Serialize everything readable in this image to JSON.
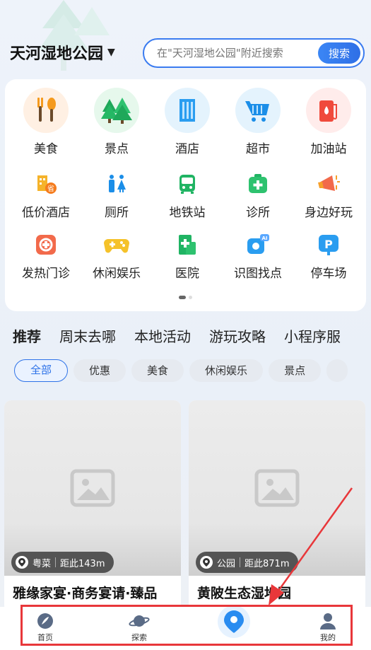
{
  "header": {
    "location": "天河湿地公园",
    "search_placeholder": "在\"天河湿地公园\"附近搜索",
    "search_button": "搜索"
  },
  "grid": {
    "row1": [
      {
        "label": "美食",
        "icon": "food-icon",
        "bg": "#fff0e3"
      },
      {
        "label": "景点",
        "icon": "trees-icon",
        "bg": "#e6f8ec"
      },
      {
        "label": "酒店",
        "icon": "building-icon",
        "bg": "#e4f3fd"
      },
      {
        "label": "超市",
        "icon": "cart-icon",
        "bg": "#e4f3fd"
      },
      {
        "label": "加油站",
        "icon": "fuel-icon",
        "bg": "#ffeceb"
      }
    ],
    "row2": [
      {
        "label": "低价酒店",
        "icon": "budget-hotel-icon"
      },
      {
        "label": "厕所",
        "icon": "toilet-icon"
      },
      {
        "label": "地铁站",
        "icon": "metro-icon"
      },
      {
        "label": "诊所",
        "icon": "clinic-icon"
      },
      {
        "label": "身边好玩",
        "icon": "megaphone-icon"
      }
    ],
    "row3": [
      {
        "label": "发热门诊",
        "icon": "fever-clinic-icon"
      },
      {
        "label": "休闲娱乐",
        "icon": "gamepad-icon"
      },
      {
        "label": "医院",
        "icon": "hospital-icon"
      },
      {
        "label": "识图找点",
        "icon": "ai-camera-icon"
      },
      {
        "label": "停车场",
        "icon": "parking-icon"
      }
    ]
  },
  "tabs": [
    "推荐",
    "周末去哪",
    "本地活动",
    "游玩攻略",
    "小程序服"
  ],
  "chips": [
    "全部",
    "优惠",
    "美食",
    "休闲娱乐",
    "景点"
  ],
  "cards": [
    {
      "category": "粤菜",
      "distance": "距此143m",
      "title": "雅缘家宴·商务宴请·臻品"
    },
    {
      "category": "公园",
      "distance": "距此871m",
      "title": "黄陂生态湿地园"
    }
  ],
  "bottom_nav": {
    "home": "首页",
    "explore": "探索",
    "mine": "我的"
  },
  "colors": {
    "accent": "#2d72e8",
    "highlight": "#e8373a"
  }
}
